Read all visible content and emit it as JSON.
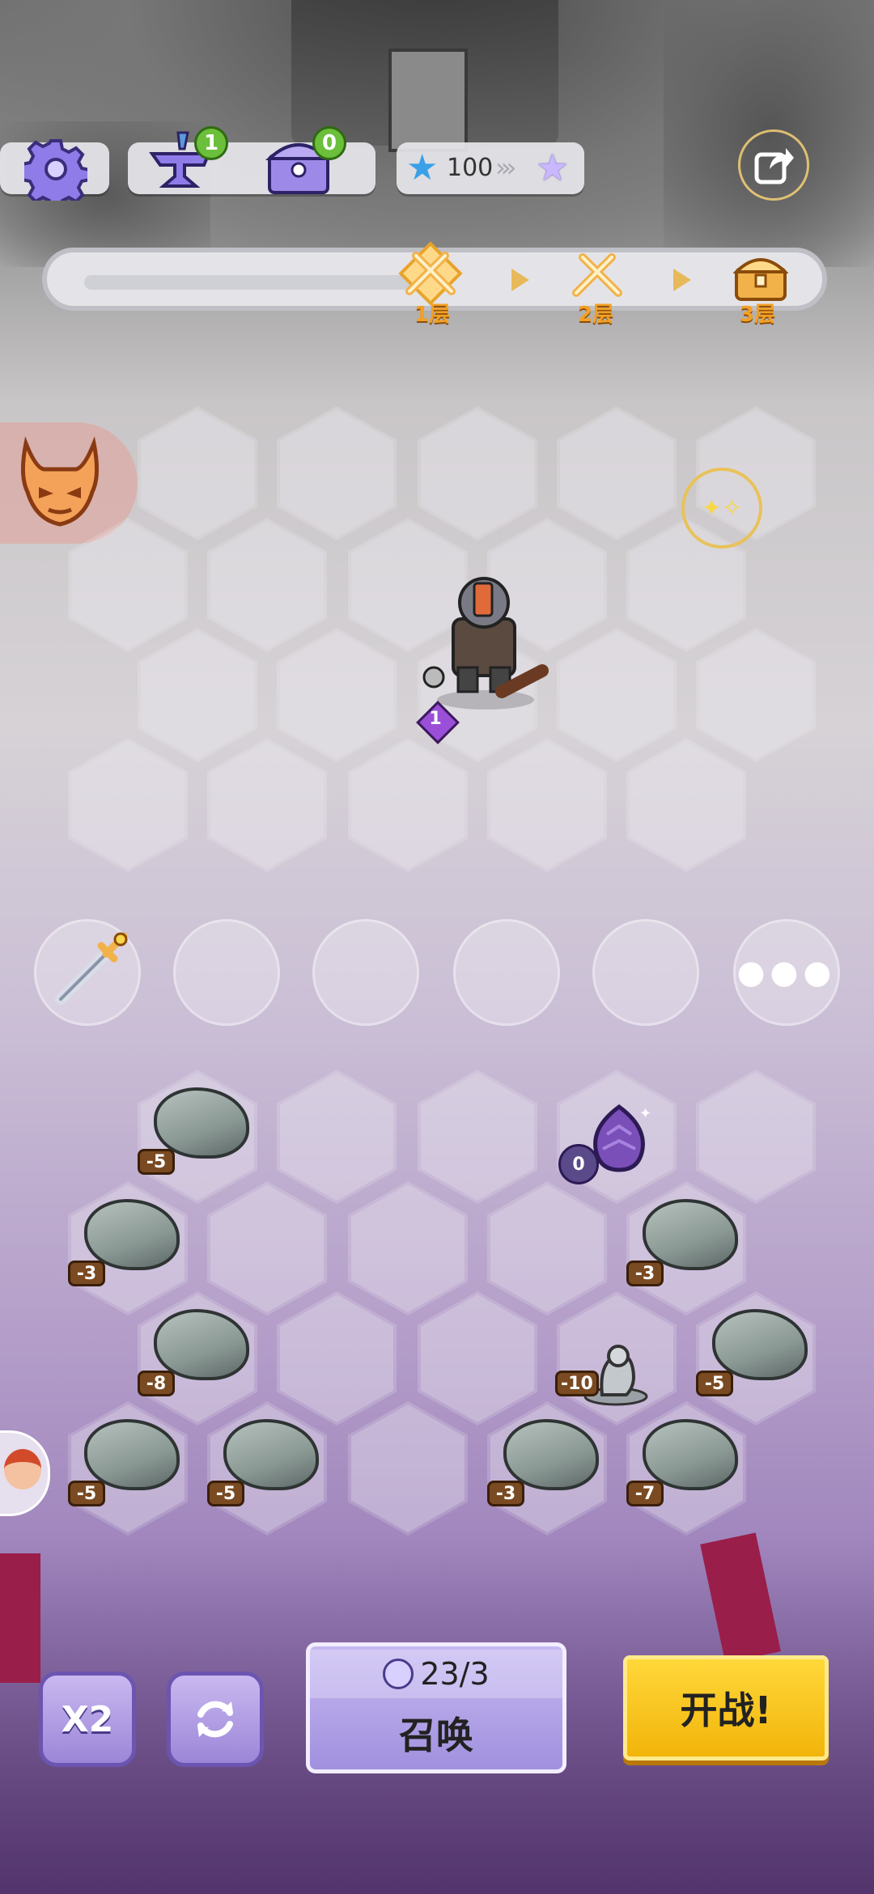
{
  "hud": {
    "settings_icon": "gear-icon",
    "anvil_count": "1",
    "chest_count": "0",
    "star_value": "100",
    "share_icon": "share-icon"
  },
  "progress": {
    "floors": [
      {
        "label": "1层",
        "icon": "crossed-swords-icon"
      },
      {
        "label": "2层",
        "icon": "crossed-swords-icon"
      },
      {
        "label": "3层",
        "icon": "treasure-chest-icon"
      }
    ],
    "current_floor_fraction": 0.0
  },
  "battlefield": {
    "hero": {
      "name": "armored-warrior",
      "level": "1"
    },
    "boss_icon": "demon-mask-icon",
    "sparkle_icon": "sparkle-icon"
  },
  "equipment_slots": {
    "slot1_icon": "dagger-icon",
    "more_icon": "more-dots-icon"
  },
  "bench": {
    "rocks": [
      "-5",
      "-3",
      "-3",
      "-8",
      "-5",
      "-5",
      "-5",
      "-3",
      "-7"
    ],
    "statue_cost": "-10",
    "egg_cost": "0"
  },
  "controls": {
    "speed_label": "X2",
    "refresh_icon": "refresh-icon",
    "summon_count": "23/3",
    "summon_label": "召唤",
    "start_label": "开战!"
  },
  "colors": {
    "accent_purple": "#9b86d8",
    "start_yellow": "#f7c21a",
    "cost_brown": "#7a4a22"
  }
}
